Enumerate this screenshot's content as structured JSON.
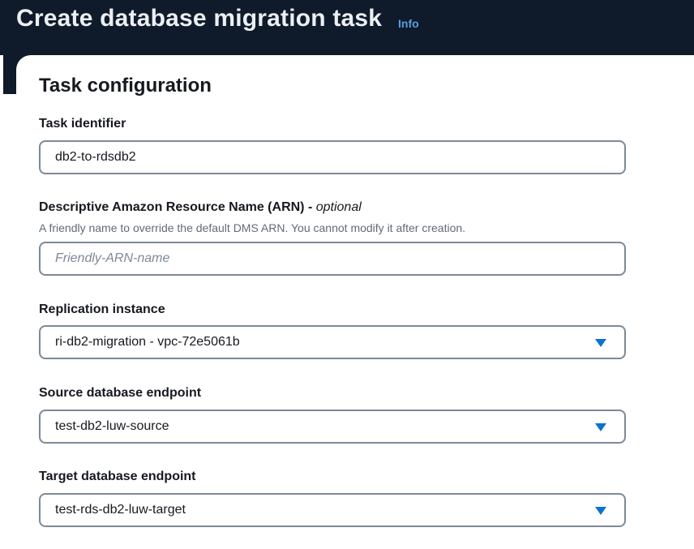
{
  "header": {
    "title": "Create database migration task",
    "info_link": "Info"
  },
  "task_configuration": {
    "section_title": "Task configuration",
    "task_identifier": {
      "label": "Task identifier",
      "value": "db2-to-rdsdb2"
    },
    "arn": {
      "label": "Descriptive Amazon Resource Name (ARN)",
      "label_suffix": " - ",
      "optional": "optional",
      "description": "A friendly name to override the default DMS ARN. You cannot modify it after creation.",
      "value": "",
      "placeholder": "Friendly-ARN-name"
    },
    "replication_instance": {
      "label": "Replication instance",
      "selected": "ri-db2-migration - vpc-72e5061b"
    },
    "source_endpoint": {
      "label": "Source database endpoint",
      "selected": "test-db2-luw-source"
    },
    "target_endpoint": {
      "label": "Target database endpoint",
      "selected": "test-rds-db2-luw-target"
    }
  },
  "colors": {
    "header_bg": "#0f1b2a",
    "accent": "#0972d3",
    "info_link": "#539fe5",
    "border": "#7d8998"
  }
}
